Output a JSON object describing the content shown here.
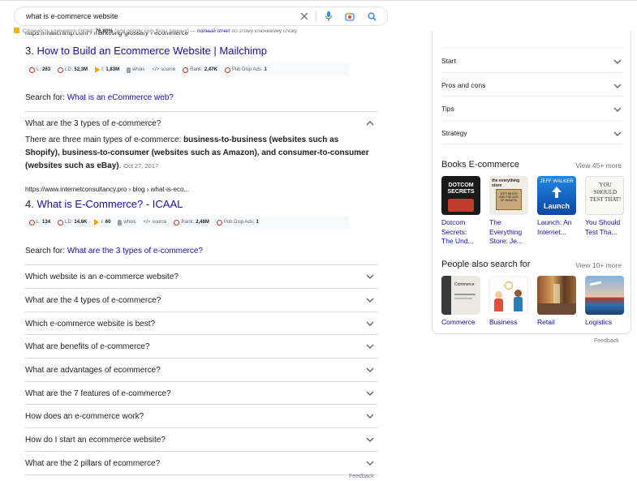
{
  "search": {
    "query": "what is e-commerce website"
  },
  "keyword_bar": {
    "prefix": "Сложность ключевого слова:",
    "value": "76.80%",
    "source": "(для google.com базы данных)",
    "dash": "—",
    "link": "полный отчет",
    "suffix": "по этому ключевому слову"
  },
  "cut_text": "https://mailchimp.com › marketing-glossary › ecommerce",
  "results": [
    {
      "number": "3.",
      "title": "How to Build an Ecommerce Website | Mailchimp",
      "metrics": {
        "l": "263",
        "ld": "52,3M",
        "i": "1,83M",
        "whois": "whois",
        "source": "source",
        "rank": "2,47K",
        "pub": "1"
      }
    },
    {
      "number": "4.",
      "title": "What is E-Commerce? - ICAAL",
      "url": "https://www.internetconsultancy.pro › blog › what-is-eco...",
      "metrics": {
        "l": "134",
        "ld": "14,6K",
        "i": "60",
        "whois": "whois",
        "source": "source",
        "rank": "2,48M",
        "pub": "1"
      }
    }
  ],
  "metric_labels": {
    "l": "L:",
    "ld": "LD:",
    "i": "I:",
    "rank": "Rank:",
    "pub": "Pub Disp Ads:"
  },
  "search_for_label": "Search for:",
  "search_for_1": "What is an eCommerce web?",
  "search_for_2": "What are the 3 types of e-commerce?",
  "expanded_question": "What are the 3 types of e-commerce?",
  "answer": {
    "lead": "There are three main types of e-commerce: ",
    "bold": "business-to-business (websites such as Shopify), business-to-consumer (websites such as Amazon), and consumer-to-consumer (websites such as eBay)",
    "tail": ".",
    "date": "Oct 27, 2017"
  },
  "questions": [
    "Which website is an e-commerce website?",
    "What are the 4 types of e-commerce?",
    "Which e-commerce website is best?",
    "What are benefits of e-commerce?",
    "What are advantages of ecommerce?",
    "What are the 7 features of e-commerce?",
    "How does an e-commerce work?",
    "How do I start an ecommerce website?",
    "What are the 2 pillars of ecommerce?"
  ],
  "feedback": "Feedback",
  "panel": {
    "rows": [
      "Start",
      "Pros and cons",
      "Tips",
      "Strategy"
    ],
    "books_title": "Books E-commerce",
    "books_more": "View 45+ more",
    "books": [
      {
        "line1": "Dotcom",
        "line2": "Secrets:",
        "line3": "The Und..."
      },
      {
        "line1": "The",
        "line2": "Everything",
        "line3": "Store: Je..."
      },
      {
        "line1": "Launch: An",
        "line2": "Internet...",
        "line3": ""
      },
      {
        "line1": "You Should",
        "line2": "Test Tha...",
        "line3": ""
      }
    ],
    "book_cover_text": {
      "b1": "DOTCOM SECRETS",
      "b2a": "the everything store",
      "b2b": "JEFF BEZOS AND THE AGE OF AMAZON",
      "b3a": "JEFF WALKER",
      "b3b": "Launch",
      "b4": "YOU SHOULD TEST THAT!"
    },
    "people_title": "People also search for",
    "people_more": "View 10+ more",
    "people": [
      "Commerce",
      "Business",
      "Retail",
      "Logistics"
    ],
    "people_cover_text": "Commerce"
  }
}
